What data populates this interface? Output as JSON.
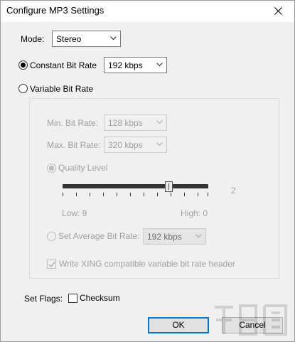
{
  "window": {
    "title": "Configure MP3 Settings"
  },
  "mode": {
    "label": "Mode:",
    "value": "Stereo"
  },
  "constant": {
    "label": "Constant Bit Rate",
    "value": "192 kbps",
    "checked": true
  },
  "variable": {
    "label": "Variable Bit Rate",
    "checked": false,
    "min_label": "Min. Bit Rate:",
    "min_value": "128 kbps",
    "max_label": "Max. Bit Rate:",
    "max_value": "320 kbps",
    "quality_label": "Quality Level",
    "quality_value": "2",
    "low_label": "Low: 9",
    "high_label": "High: 0",
    "avg_label": "Set Average Bit Rate:",
    "avg_value": "192 kbps",
    "xing_label": "Write XING compatible variable bit rate header"
  },
  "flags": {
    "label": "Set Flags:",
    "checksum_label": "Checksum"
  },
  "buttons": {
    "ok": "OK",
    "cancel": "Cancel"
  },
  "colors": {
    "accent": "#0078d7",
    "disabled_text": "#a0a0a0",
    "dialog_bg": "#f0f0f0"
  }
}
